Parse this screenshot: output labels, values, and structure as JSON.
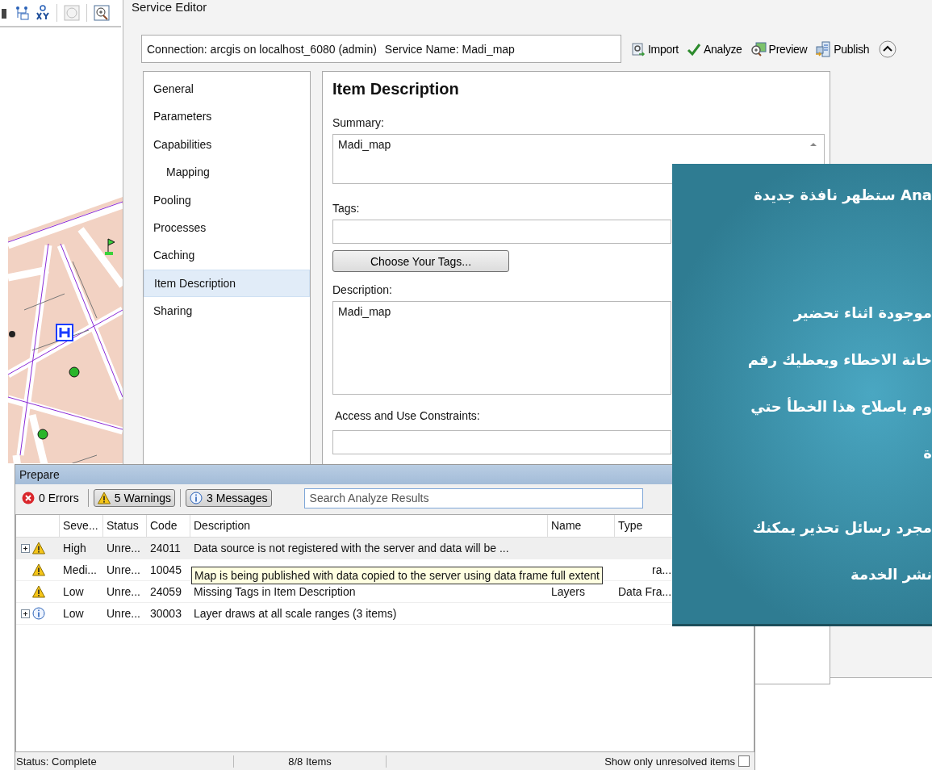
{
  "window": {
    "title": "Service Editor"
  },
  "connection": {
    "connection": "Connection: arcgis on localhost_6080 (admin)",
    "service": "Service Name: Madi_map"
  },
  "actions": [
    {
      "kind": "import",
      "label": "Import"
    },
    {
      "kind": "analyze",
      "label": "Analyze"
    },
    {
      "kind": "preview",
      "label": "Preview"
    },
    {
      "kind": "publish",
      "label": "Publish"
    }
  ],
  "nav": [
    {
      "label": "General",
      "selected": false
    },
    {
      "label": "Parameters",
      "selected": false
    },
    {
      "label": "Capabilities",
      "selected": false,
      "children": [
        {
          "label": "Mapping",
          "selected": false
        }
      ]
    },
    {
      "label": "Pooling",
      "selected": false
    },
    {
      "label": "Processes",
      "selected": false
    },
    {
      "label": "Caching",
      "selected": false
    },
    {
      "label": "Item Description",
      "selected": true
    },
    {
      "label": "Sharing",
      "selected": false
    }
  ],
  "panel": {
    "title": "Item Description",
    "fields": [
      {
        "kind": "summary",
        "label": "Summary:",
        "value": "Madi_map"
      },
      {
        "kind": "tags",
        "label": "Tags:",
        "button": "Choose Your Tags..."
      },
      {
        "kind": "description",
        "label": "Description:",
        "value": "Madi_map"
      },
      {
        "kind": "constraints",
        "label": "Access and Use Constraints:"
      }
    ]
  },
  "prepare": {
    "title": "Prepare",
    "filters": [
      {
        "kind": "error",
        "label": "0 Errors",
        "selected": false
      },
      {
        "kind": "warning",
        "label": "5 Warnings",
        "selected": true
      },
      {
        "kind": "info",
        "label": "3 Messages",
        "selected": true
      }
    ],
    "search": {
      "placeholder": "Search Analyze Results"
    },
    "columns": [
      "Seve...",
      "Status",
      "Code",
      "Description",
      "Name",
      "Type"
    ],
    "rows": [
      {
        "expandable": true,
        "kind": "warning",
        "severity": "High",
        "status": "Unre...",
        "code": "24011",
        "description": "Data source is not registered with the server and data will be ...",
        "selected": true
      },
      {
        "expandable": false,
        "kind": "warning",
        "severity": "Medi...",
        "status": "Unre...",
        "code": "10045",
        "tooltip": "Map is being published with data copied to the server using data frame full extent",
        "type": "ra...",
        "selected": false
      },
      {
        "expandable": false,
        "kind": "warning",
        "severity": "Low",
        "status": "Unre...",
        "code": "24059",
        "description": "Missing Tags in Item Description",
        "name": "Layers",
        "type": "Data Fra...",
        "selected": false
      },
      {
        "expandable": true,
        "kind": "info",
        "severity": "Low",
        "status": "Unre...",
        "code": "30003",
        "description": "Layer draws at all scale ranges (3 items)",
        "selected": false
      }
    ],
    "status_bar": {
      "status": "Status: Complete",
      "count": "8/8 Items",
      "filter_label": "Show only unresolved items",
      "checked": false
    }
  },
  "callout": {
    "paragraphs": [
      [
        "Ana  ستظهر نافذة جديدة"
      ],
      [
        "موجودة اثناء تحضير",
        "خانة الاخطاء ويعطيك رقم",
        "وم باصلاح هذا الخطأ حتي",
        "ة"
      ],
      [
        "مجرد رسائل  تحذير يمكنك",
        "نشر الخدمة"
      ]
    ]
  }
}
